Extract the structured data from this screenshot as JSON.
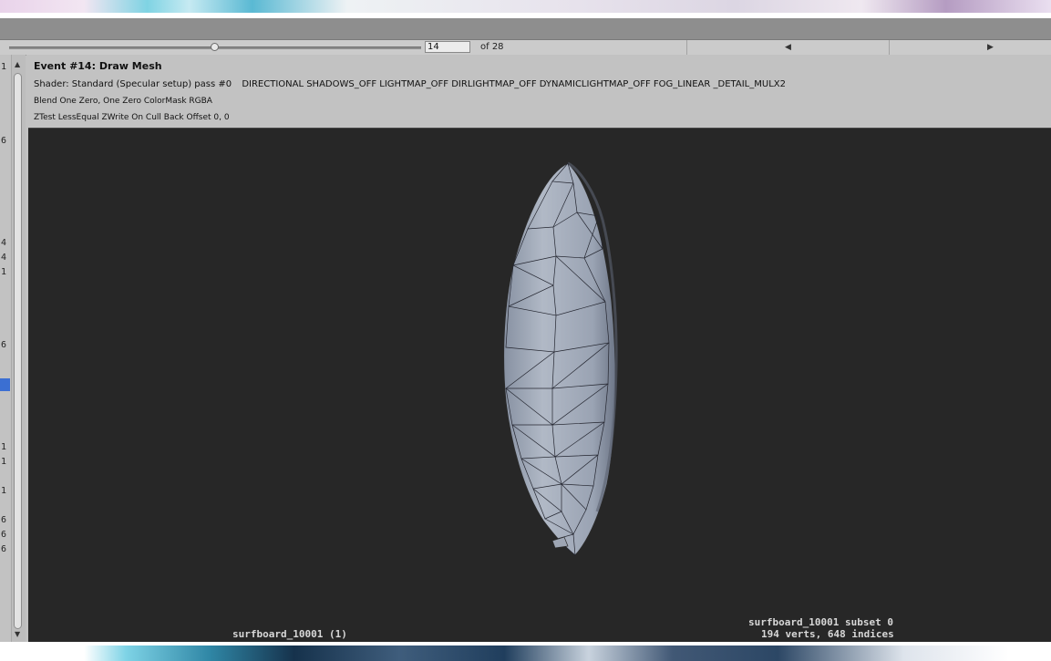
{
  "navigation": {
    "event_index": "14",
    "of_total": "of 28",
    "prev_icon": "left-triangle-icon",
    "next_icon": "right-triangle-icon"
  },
  "scrubber": {
    "position_fraction": 0.5
  },
  "gutter": {
    "numbers": [
      "1",
      "6",
      "4",
      "4",
      "1",
      "6",
      "1",
      "1",
      "1",
      "6",
      "6",
      "6"
    ],
    "selected_color": "#3b6fd2"
  },
  "event": {
    "title": "Event #14: Draw Mesh",
    "shader_label": "Shader: Standard (Specular setup) pass #0",
    "keywords": "DIRECTIONAL SHADOWS_OFF LIGHTMAP_OFF DIRLIGHTMAP_OFF DYNAMICLIGHTMAP_OFF FOG_LINEAR _DETAIL_MULX2",
    "blend": "Blend One Zero, One Zero ColorMask RGBA",
    "ztest": "ZTest LessEqual ZWrite On Cull Back Offset 0, 0"
  },
  "viewport": {
    "background": "#272727",
    "mesh_color": "#a9b1bf",
    "left_label": "surfboard_10001 (1)",
    "right_label_1": "surfboard_10001 subset 0",
    "right_label_2": "194 verts, 648 indices"
  }
}
